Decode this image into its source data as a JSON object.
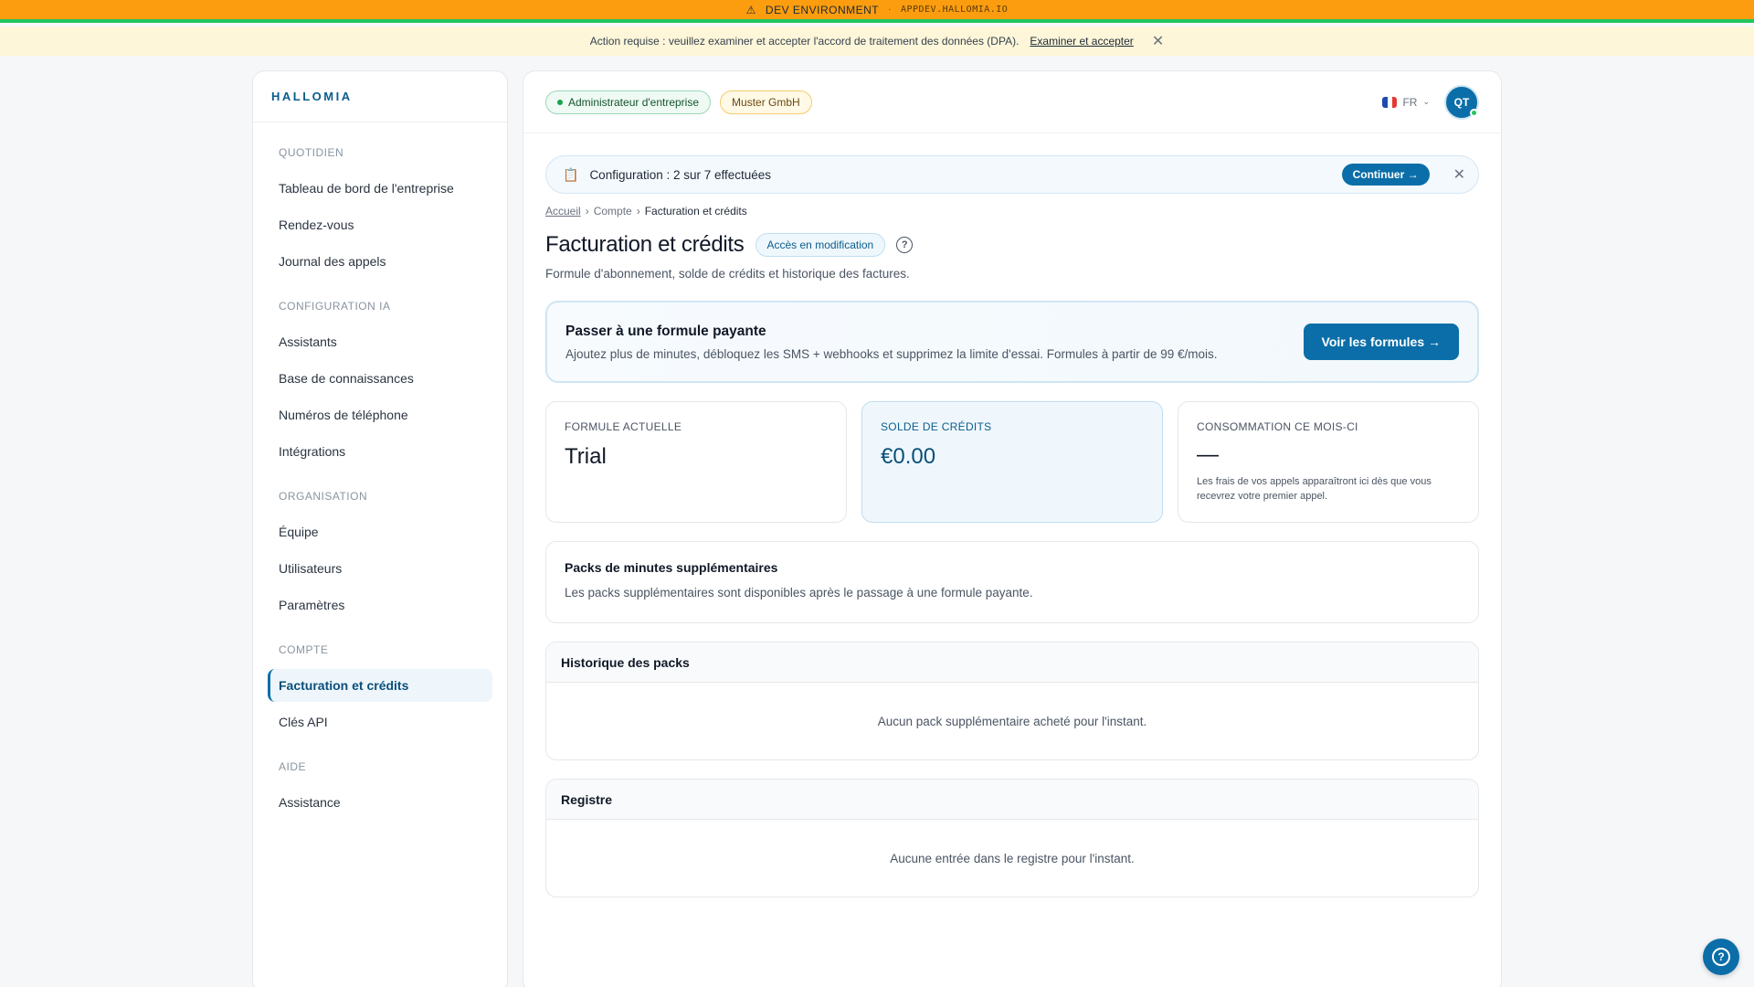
{
  "dev_banner": {
    "icon": "warning-icon",
    "label": "DEV ENVIRONMENT",
    "separator": "·",
    "host": "APPDEV.HALLOMIA.IO"
  },
  "dpa_banner": {
    "message": "Action requise : veuillez examiner et accepter l'accord de traitement des données (DPA).",
    "link": "Examiner et accepter",
    "close": "✕"
  },
  "sidebar": {
    "brand": "HALLOMIA",
    "sections": [
      {
        "title": "QUOTIDIEN",
        "items": [
          "Tableau de bord de l'entreprise",
          "Rendez-vous",
          "Journal des appels"
        ]
      },
      {
        "title": "CONFIGURATION IA",
        "items": [
          "Assistants",
          "Base de connaissances",
          "Numéros de téléphone",
          "Intégrations"
        ]
      },
      {
        "title": "ORGANISATION",
        "items": [
          "Équipe",
          "Utilisateurs",
          "Paramètres"
        ]
      },
      {
        "title": "COMPTE",
        "items": [
          "Facturation et crédits",
          "Clés API"
        ]
      },
      {
        "title": "AIDE",
        "items": [
          "Assistance"
        ]
      }
    ],
    "active_item": "Facturation et crédits"
  },
  "topbar": {
    "role": "Administrateur d'entreprise",
    "organization": "Muster GmbH",
    "language": "FR",
    "flag_colors": [
      "#1f4bb0",
      "#ffffff",
      "#e53935"
    ],
    "avatar_initials": "QT"
  },
  "setup": {
    "text": "Configuration : 2 sur 7 effectuées",
    "continue": "Continuer →",
    "close": "✕"
  },
  "breadcrumb": {
    "home": "Accueil",
    "section": "Compte",
    "current": "Facturation et crédits",
    "sep": "›"
  },
  "page": {
    "title": "Facturation et crédits",
    "access_badge": "Accès en modification",
    "help": "?",
    "subtitle": "Formule d'abonnement, solde de crédits et historique des factures."
  },
  "upgrade": {
    "title": "Passer à une formule payante",
    "description": "Ajoutez plus de minutes, débloquez les SMS + webhooks et supprimez la limite d'essai. Formules à partir de 99 €/mois.",
    "button": "Voir les formules →"
  },
  "cards": {
    "plan": {
      "label": "FORMULE ACTUELLE",
      "value": "Trial"
    },
    "credits": {
      "label": "SOLDE DE CRÉDITS",
      "value": "€0.00"
    },
    "usage": {
      "label": "CONSOMMATION CE MOIS-CI",
      "value": "—",
      "note": "Les frais de vos appels apparaîtront ici dès que vous recevrez votre premier appel."
    }
  },
  "packs": {
    "title": "Packs de minutes supplémentaires",
    "text": "Les packs supplémentaires sont disponibles après le passage à une formule payante."
  },
  "history": {
    "title": "Historique des packs",
    "empty": "Aucun pack supplémentaire acheté pour l'instant."
  },
  "ledger": {
    "title": "Registre",
    "empty": "Aucune entrée dans le registre pour l'instant."
  },
  "fab": {
    "icon": "help-icon",
    "label": "?"
  }
}
